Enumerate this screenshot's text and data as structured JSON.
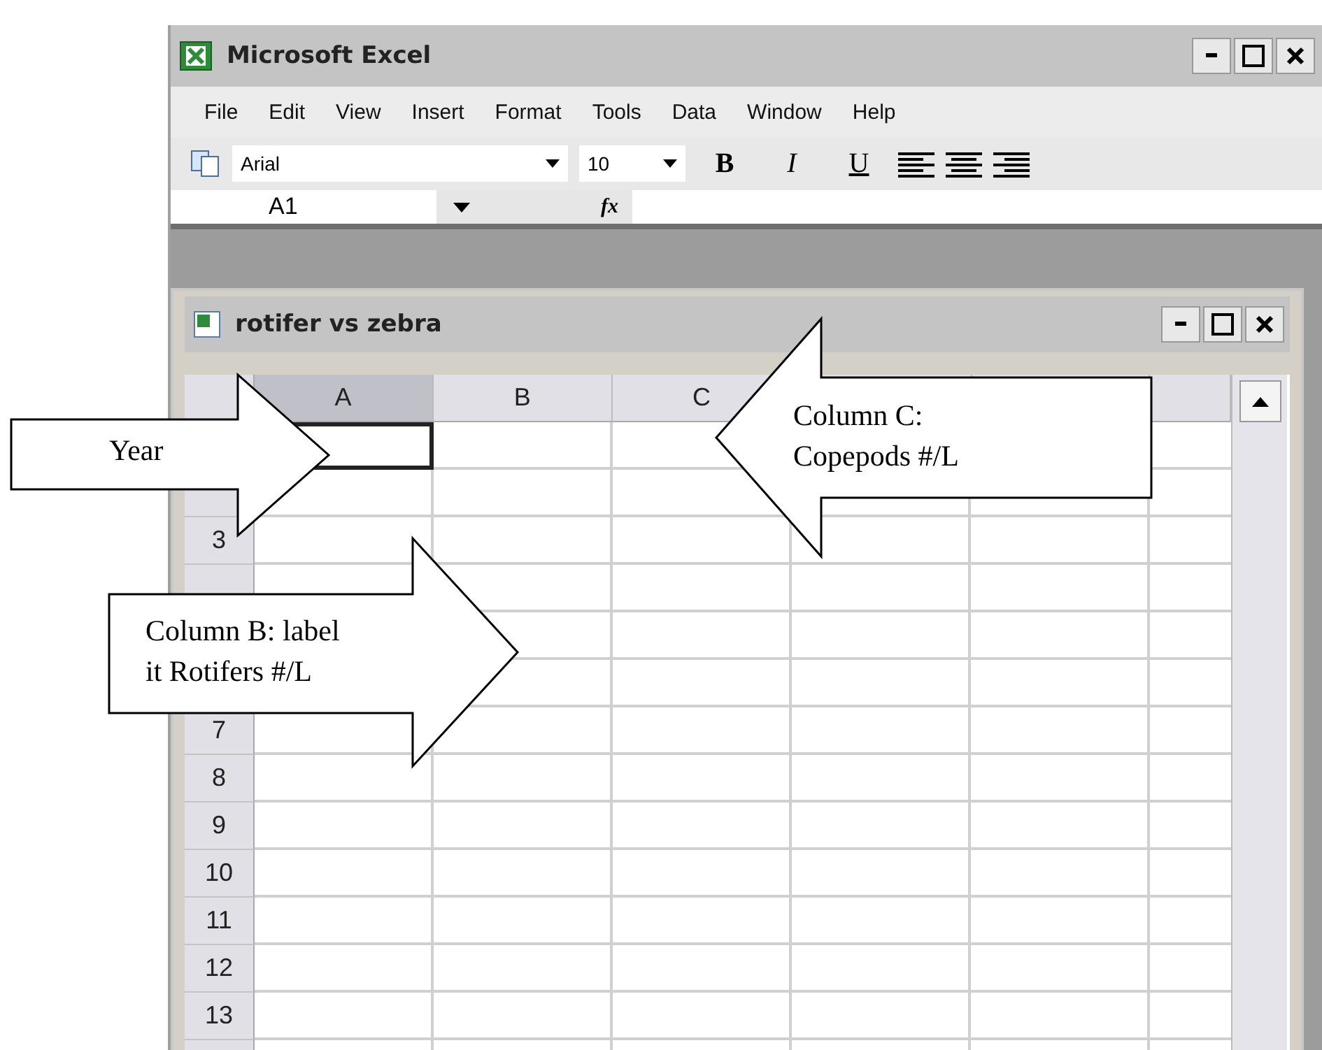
{
  "window": {
    "title": "Microsoft Excel"
  },
  "menu": [
    "File",
    "Edit",
    "View",
    "Insert",
    "Format",
    "Tools",
    "Data",
    "Window",
    "Help"
  ],
  "toolbar": {
    "font": "Arial",
    "size": "10",
    "format_buttons": [
      {
        "label": "B",
        "kind": "bold"
      },
      {
        "label": "I",
        "kind": "italic"
      },
      {
        "label": "U",
        "kind": "underline"
      }
    ]
  },
  "formula_bar": {
    "name_box": "A1",
    "fx": "fx"
  },
  "workbook": {
    "title": "rotifer vs zebra",
    "column_headers": [
      {
        "label": "A",
        "selected": true
      },
      {
        "label": "B",
        "selected": false
      },
      {
        "label": "C",
        "selected": false
      }
    ],
    "row_headers": [
      "3",
      "7",
      "8",
      "9",
      "10",
      "11",
      "12",
      "13"
    ]
  },
  "callouts": [
    {
      "text": "Year",
      "kind": "rightward"
    },
    {
      "text": "Column C: Copepods #/L",
      "kind": "leftward"
    },
    {
      "text": "Column B: label it Rotifers #/L",
      "kind": "rightward"
    }
  ]
}
